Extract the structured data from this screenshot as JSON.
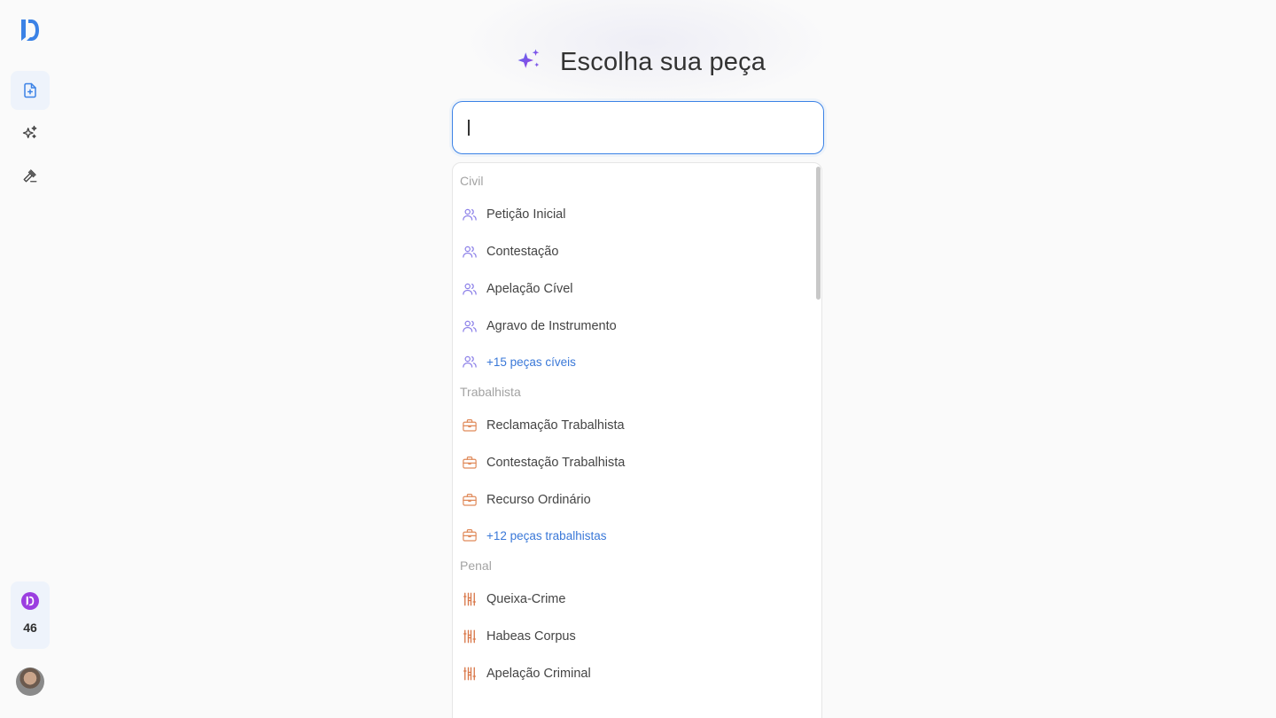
{
  "sidebar": {
    "logo_icon": "brand-logo-icon",
    "nav": [
      {
        "icon": "file-plus-icon",
        "active": true
      },
      {
        "icon": "sparkles-icon",
        "active": false
      },
      {
        "icon": "gavel-icon",
        "active": false
      }
    ],
    "credits": {
      "icon": "brand-coin-icon",
      "count": "46"
    },
    "avatar": "user-avatar"
  },
  "header": {
    "icon": "sparkles-icon",
    "title": "Escolha sua peça"
  },
  "search": {
    "value": "",
    "placeholder": ""
  },
  "dropdown": {
    "groups": [
      {
        "label": "Civil",
        "icon": "users-icon",
        "icon_color": "#8a7ee8",
        "items": [
          "Petição Inicial",
          "Contestação",
          "Apelação Cível",
          "Agravo de Instrumento"
        ],
        "more": "+15 peças cíveis"
      },
      {
        "label": "Trabalhista",
        "icon": "briefcase-icon",
        "icon_color": "#e08a5a",
        "items": [
          "Reclamação Trabalhista",
          "Contestação Trabalhista",
          "Recurso Ordinário"
        ],
        "more": "+12 peças trabalhistas"
      },
      {
        "label": "Penal",
        "icon": "prison-bars-icon",
        "icon_color": "#d9784a",
        "items": [
          "Queixa-Crime",
          "Habeas Corpus",
          "Apelação Criminal"
        ]
      }
    ]
  },
  "colors": {
    "accent": "#3b82e6",
    "link": "#3a78d8",
    "brand_purple": "#9b3ee0"
  }
}
